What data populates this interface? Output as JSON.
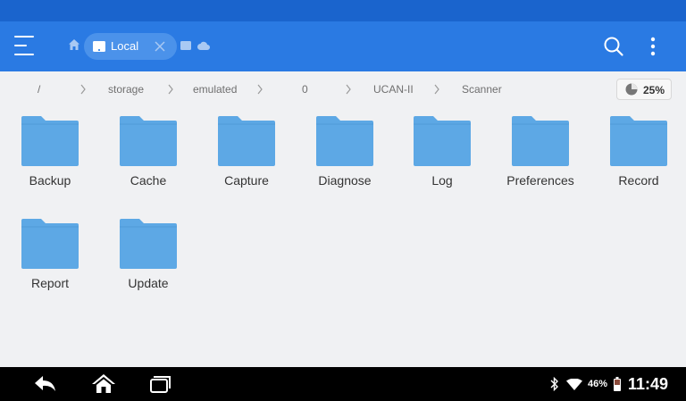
{
  "colors": {
    "status_bar": "#1a64cd",
    "app_bar": "#2a7ae3",
    "chip": "#4b92ea",
    "folder": "#5da8e5",
    "background": "#f0f1f3",
    "nav_bar": "#000000"
  },
  "toolbar": {
    "menu_icon": "hamburger-menu-icon",
    "home_icon": "home-icon",
    "active_tab": {
      "label": "Local",
      "icon": "tablet-icon",
      "close_icon": "close-icon"
    },
    "other_tab_icons": [
      "tablet-icon",
      "cloud-icon"
    ],
    "search_icon": "search-icon",
    "more_icon": "more-vertical-icon"
  },
  "breadcrumb": {
    "items": [
      "/",
      "storage",
      "emulated",
      "0",
      "UCAN-II",
      "Scanner"
    ],
    "separator_icon": "chevron-right-icon"
  },
  "storage_usage": {
    "icon": "pie-chart-icon",
    "percent_label": "25%",
    "value": 0.25
  },
  "folders": [
    {
      "label": "Backup"
    },
    {
      "label": "Cache"
    },
    {
      "label": "Capture"
    },
    {
      "label": "Diagnose"
    },
    {
      "label": "Log"
    },
    {
      "label": "Preferences"
    },
    {
      "label": "Record"
    },
    {
      "label": "Report"
    },
    {
      "label": "Update"
    }
  ],
  "navigation_bar": {
    "back_icon": "back-icon",
    "home_icon": "home-icon",
    "recents_icon": "recents-icon"
  },
  "system_status": {
    "bluetooth_icon": "bluetooth-icon",
    "wifi_icon": "wifi-icon",
    "battery_icon": "battery-icon",
    "battery_percent": "46%",
    "time": "11:49"
  }
}
